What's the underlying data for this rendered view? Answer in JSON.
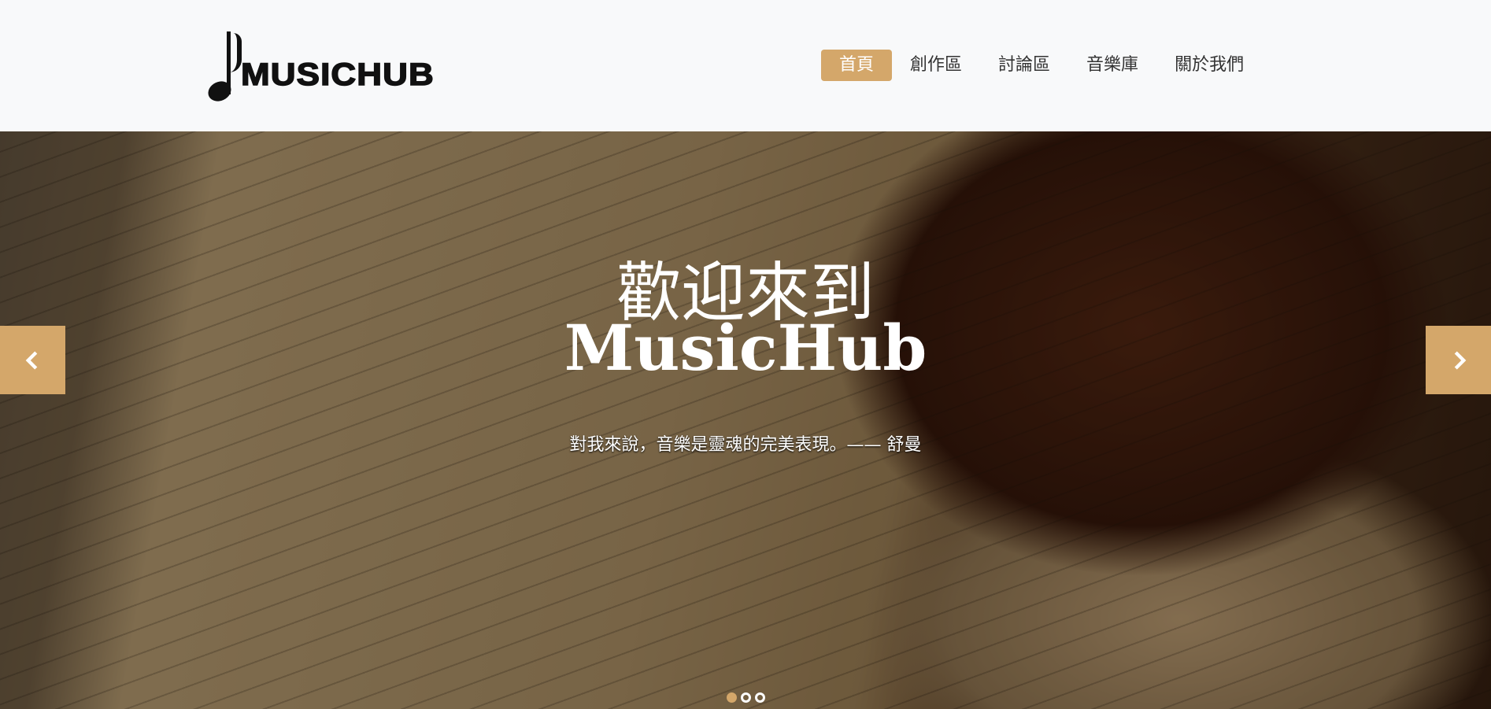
{
  "brand": {
    "logo_text": "MUSICHUB"
  },
  "nav": {
    "items": [
      {
        "label": "首頁",
        "active": true
      },
      {
        "label": "創作區"
      },
      {
        "label": "討論區"
      },
      {
        "label": "音樂庫"
      },
      {
        "label": "關於我們"
      }
    ]
  },
  "hero": {
    "title_line1": "歡迎來到",
    "title_line2": "MusicHub",
    "quote": "對我來說，音樂是靈魂的完美表現。—— 舒曼",
    "slide_count": 3,
    "active_slide": 1
  },
  "colors": {
    "accent": "#d4a76a",
    "header_bg": "#f8f9fa"
  }
}
